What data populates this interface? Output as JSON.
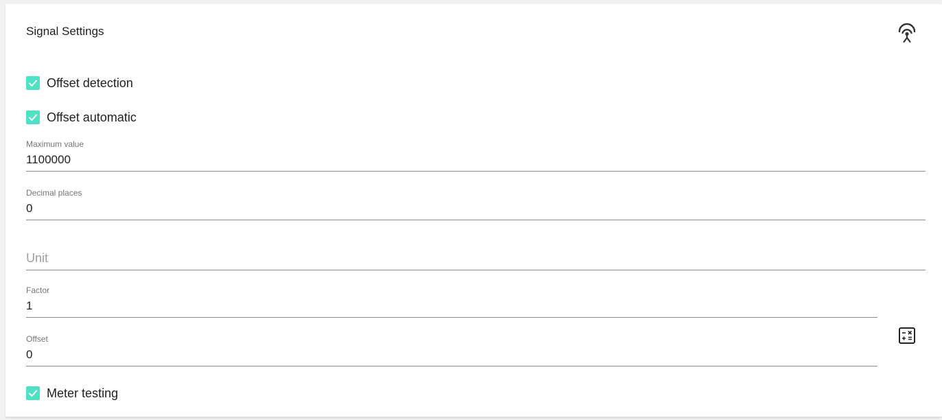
{
  "card": {
    "title": "Signal Settings"
  },
  "checkboxes": {
    "offset_detection": {
      "label": "Offset detection",
      "checked": true
    },
    "offset_automatic": {
      "label": "Offset automatic",
      "checked": true
    },
    "meter_testing": {
      "label": "Meter testing",
      "checked": true
    }
  },
  "fields": {
    "maximum_value": {
      "label": "Maximum value",
      "value": "1100000"
    },
    "decimal_places": {
      "label": "Decimal places",
      "value": "0"
    },
    "unit": {
      "placeholder": "Unit",
      "value": ""
    },
    "factor": {
      "label": "Factor",
      "value": "1"
    },
    "offset": {
      "label": "Offset",
      "value": "0"
    }
  },
  "icons": {
    "signal": "signal-antenna-icon",
    "calculator": "calculator-icon"
  },
  "colors": {
    "checkbox_accent": "#4fe1c4",
    "text": "#212121",
    "label": "#757575",
    "underline": "#8a8a8a"
  }
}
